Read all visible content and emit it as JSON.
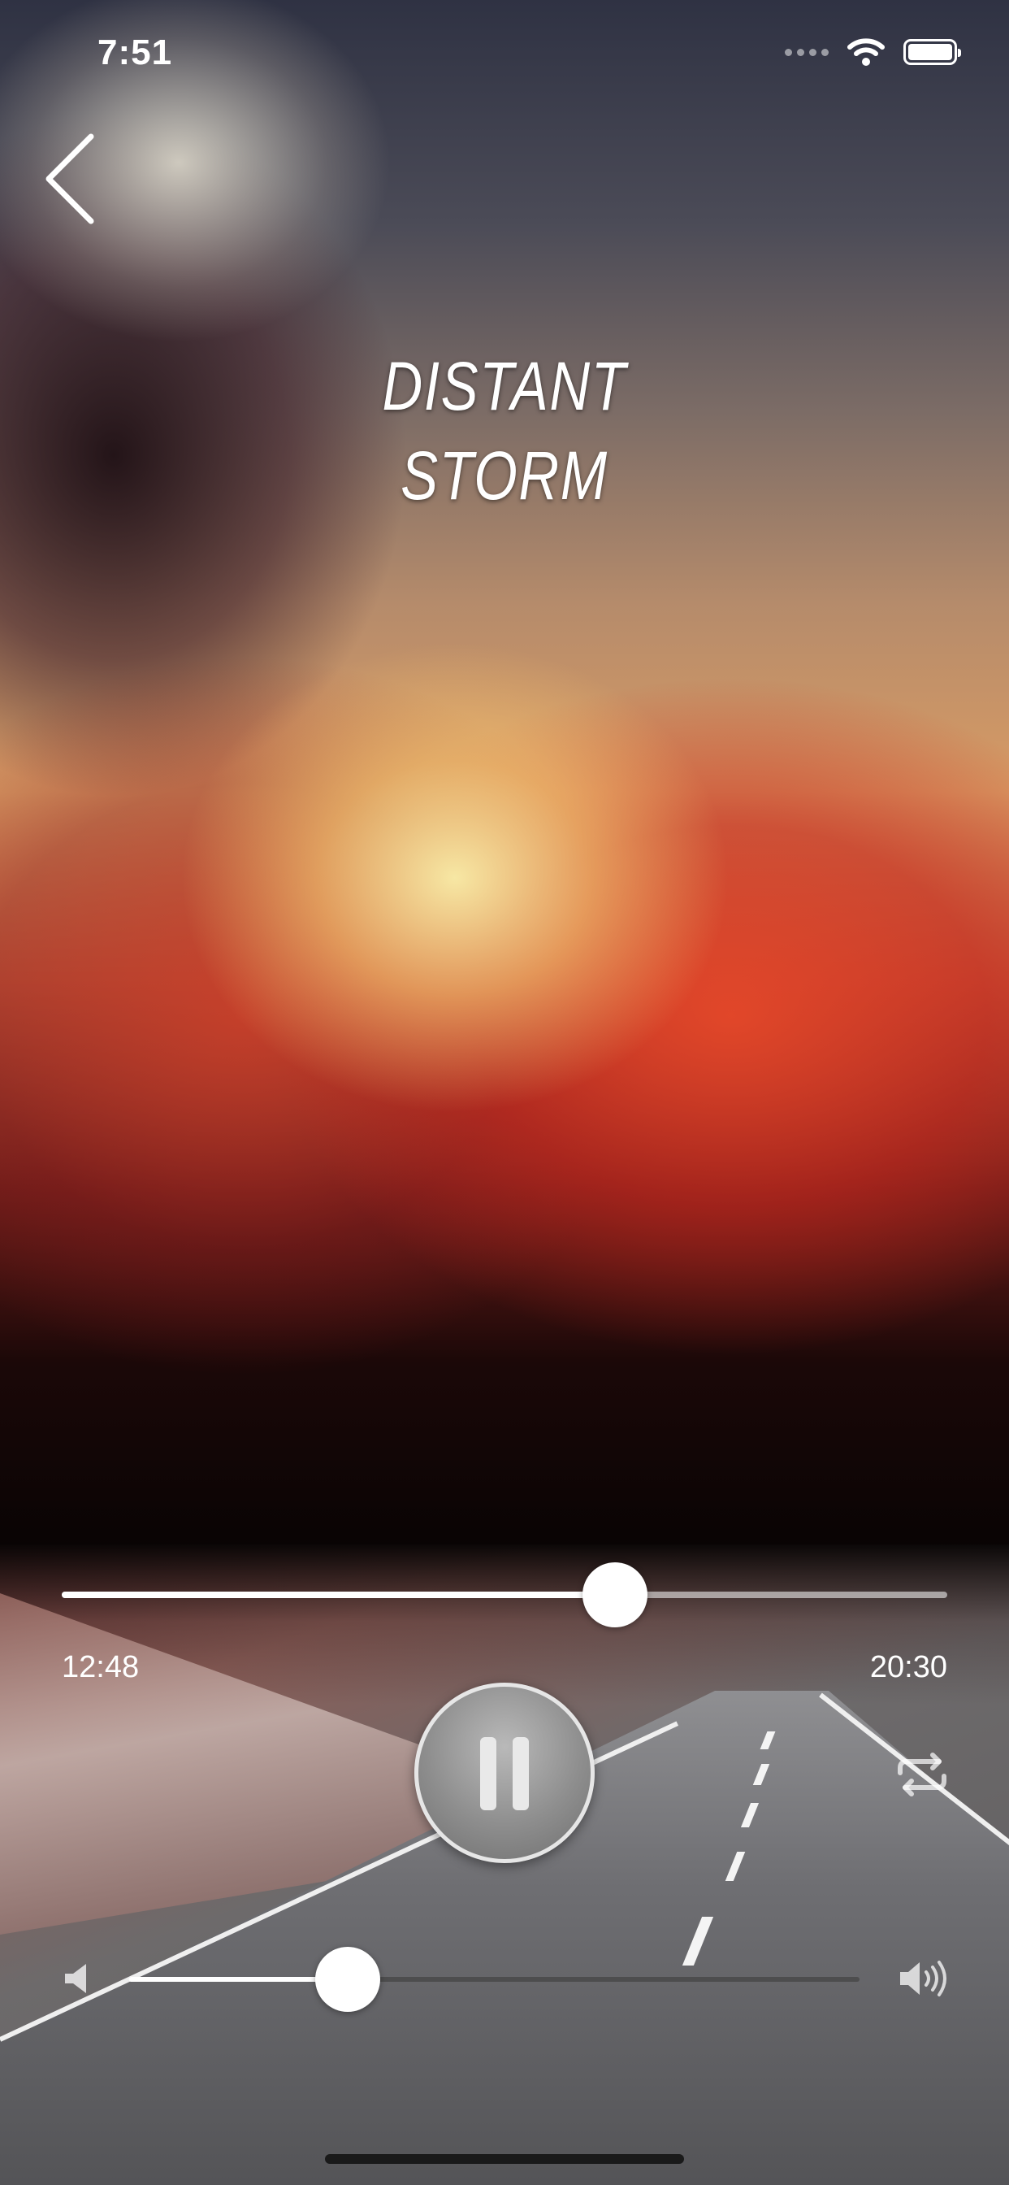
{
  "status_bar": {
    "time": "7:51",
    "icons": [
      "cellular-signal-icon",
      "wifi-icon",
      "battery-icon"
    ]
  },
  "header": {
    "back_icon": "chevron-left-icon"
  },
  "track": {
    "title_line1": "DISTANT",
    "title_line2": "STORM"
  },
  "playback": {
    "elapsed": "12:48",
    "duration": "20:30",
    "progress": 0.6244,
    "state_icon": "pause-icon",
    "repeat_icon": "repeat-icon"
  },
  "volume": {
    "level": 0.3,
    "low_icon": "speaker-low-icon",
    "high_icon": "speaker-high-icon"
  },
  "colors": {
    "accent": "#ffffff",
    "control_gray": "#8e8e8e"
  }
}
